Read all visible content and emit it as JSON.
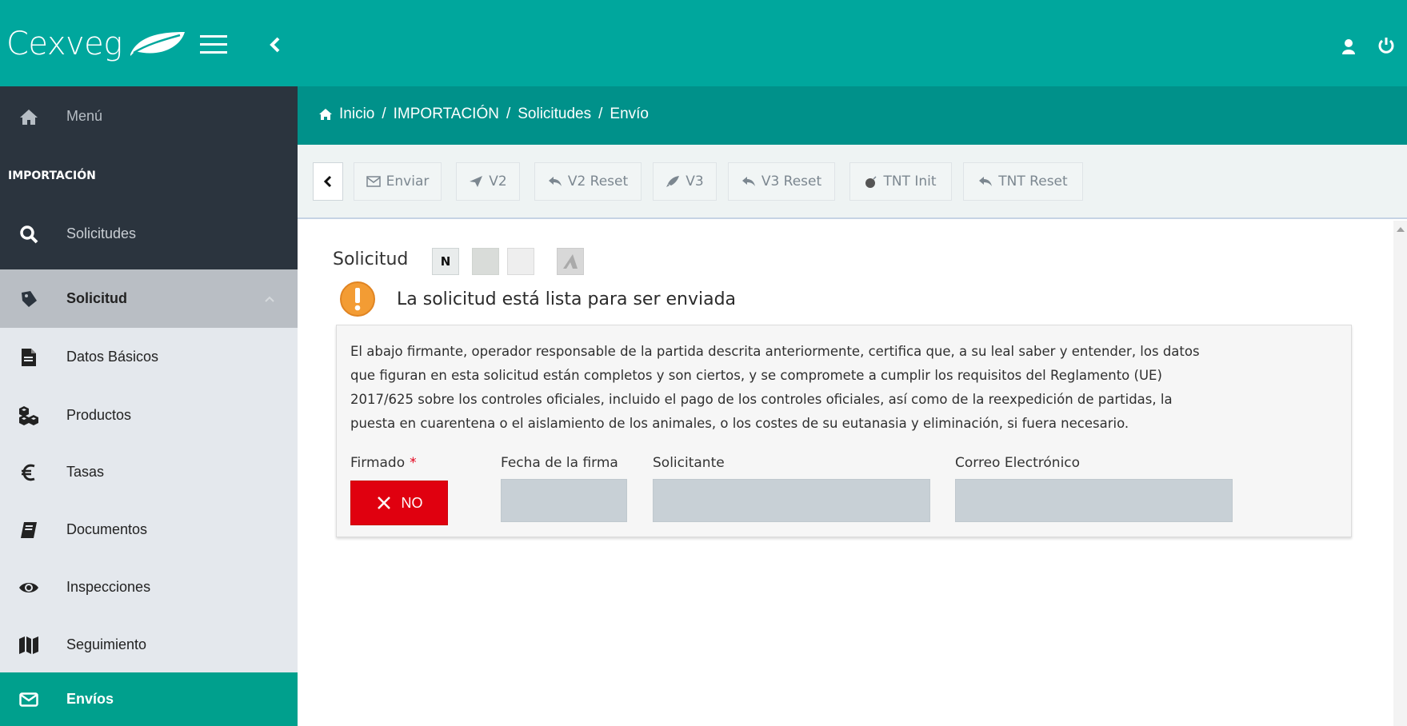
{
  "app": {
    "brand": "Cexveg"
  },
  "topbar": {
    "icons": [
      "leaf-icon",
      "hamburger-icon",
      "chevron-left-icon",
      "user-icon",
      "power-icon"
    ],
    "color": "#00a79d"
  },
  "sidebar": {
    "menu_label": "Menú",
    "section_header": "IMPORTACIÓN",
    "items": [
      {
        "label": "Solicitudes",
        "icon": "search-icon"
      },
      {
        "label": "Solicitud",
        "icon": "tag-icon"
      },
      {
        "label": "Datos Básicos",
        "icon": "file-icon"
      },
      {
        "label": "Productos",
        "icon": "cubes-icon"
      },
      {
        "label": "Tasas",
        "icon": "euro-icon"
      },
      {
        "label": "Documentos",
        "icon": "book-icon"
      },
      {
        "label": "Inspecciones",
        "icon": "eye-icon"
      },
      {
        "label": "Seguimiento",
        "icon": "map-icon"
      },
      {
        "label": "Envíos",
        "icon": "envelope-icon"
      }
    ],
    "active_color": "#00a08d"
  },
  "breadcrumb": {
    "home": "Inicio",
    "items": [
      "IMPORTACIÓN",
      "Solicitudes",
      "Envío"
    ],
    "separator": "/"
  },
  "toolbar": {
    "buttons": [
      {
        "label": "Enviar",
        "icon": "envelope-icon"
      },
      {
        "label": "V2",
        "icon": "send-icon"
      },
      {
        "label": "V2 Reset",
        "icon": "reply-icon"
      },
      {
        "label": "V3",
        "icon": "rocket-icon"
      },
      {
        "label": "V3 Reset",
        "icon": "reply-icon"
      },
      {
        "label": "TNT Init",
        "icon": "bomb-icon"
      },
      {
        "label": "TNT Reset",
        "icon": "reply-icon"
      }
    ]
  },
  "main": {
    "title": "Solicitud",
    "badge_n": "N",
    "alert": "La solicitud está lista para ser enviada",
    "declaration_lines": [
      "El abajo firmante, operador responsable de la partida descrita anteriormente, certifica que, a su leal saber y entender, los datos",
      "que figuran en esta solicitud están completos y son ciertos, y se compromete a cumplir los requisitos del Reglamento (UE)",
      "2017/625 sobre los controles oficiales, incluido el pago de los controles oficiales, así como de la reexpedición de partidas, la",
      "puesta en cuarentena o el aislamiento de los animales, o los costes de su eutanasia y eliminación, si fuera necesario."
    ],
    "fields": {
      "firmado_label": "Firmado",
      "required_mark": "*",
      "firmado_value": "NO",
      "fecha_label": "Fecha de la firma",
      "fecha_value": "",
      "solicitante_label": "Solicitante",
      "solicitante_value": "",
      "correo_label": "Correo Electrónico",
      "correo_value": ""
    },
    "colors": {
      "alert_icon": "#f39c34",
      "no_button": "#e0000f"
    }
  }
}
